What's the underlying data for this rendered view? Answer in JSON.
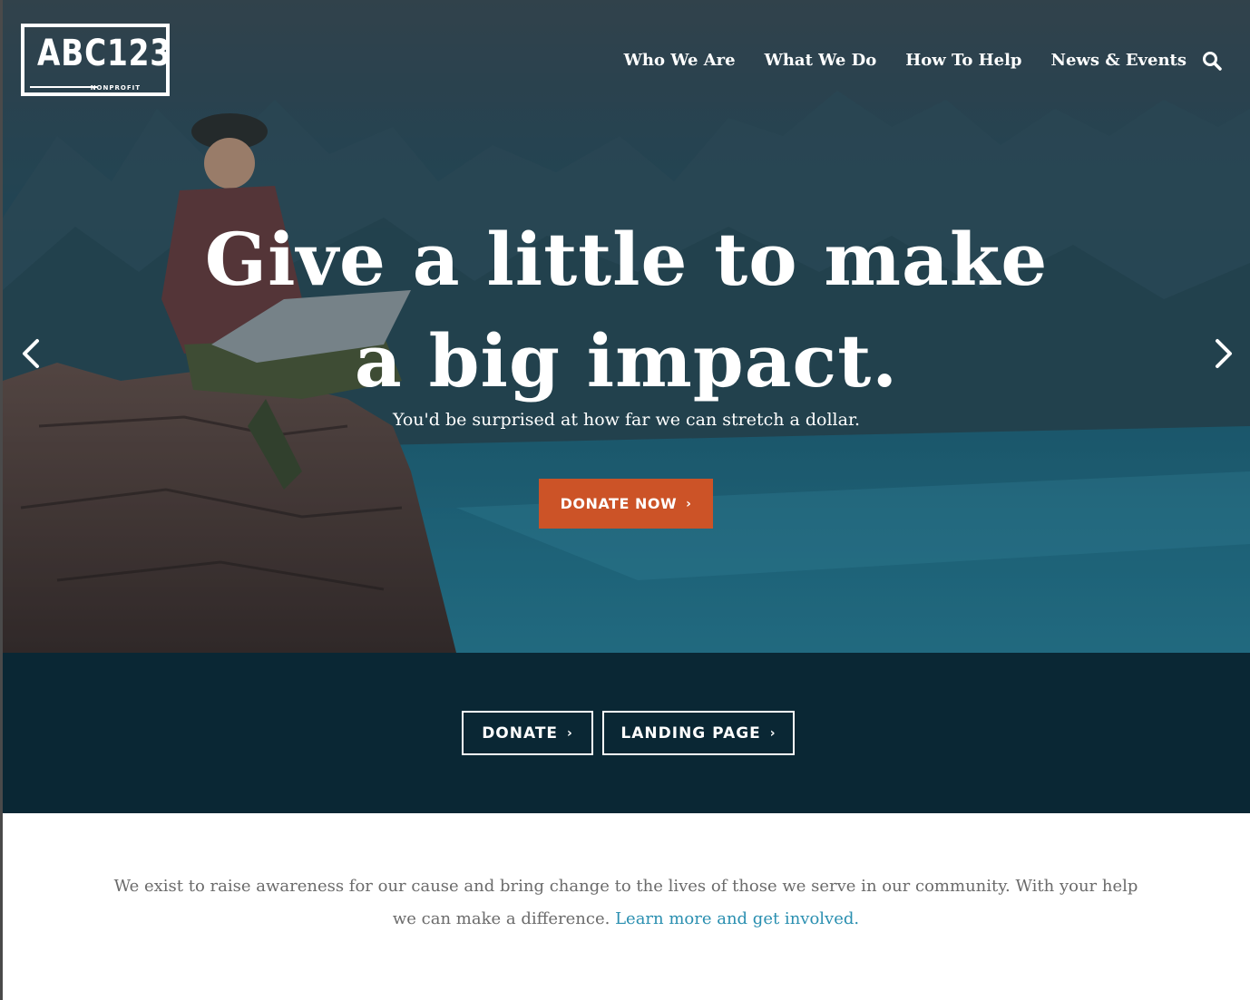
{
  "brand": {
    "logo_text": "ABC123",
    "logo_subtext": "NONPROFIT"
  },
  "nav": {
    "items": [
      "Who We Are",
      "What We Do",
      "How To Help",
      "News & Events"
    ],
    "search_icon": "search-icon"
  },
  "hero": {
    "headline_line1": "Give a little to make",
    "headline_line2": "a big impact.",
    "subheadline": "You'd be surprised at how far we can stretch a dollar.",
    "cta_label": "DONATE NOW",
    "prev_icon": "chevron-left-icon",
    "next_icon": "chevron-right-icon"
  },
  "actions": {
    "donate_label": "DONATE",
    "landing_label": "LANDING PAGE"
  },
  "intro": {
    "text": "We exist to raise awareness for our cause and bring change to the lives of those we serve in our community. With your help we can make a difference.",
    "link_text": "Learn more and get involved."
  },
  "colors": {
    "accent": "#cc5327",
    "band_bg": "#0a2734",
    "link": "#2a8fb0"
  }
}
